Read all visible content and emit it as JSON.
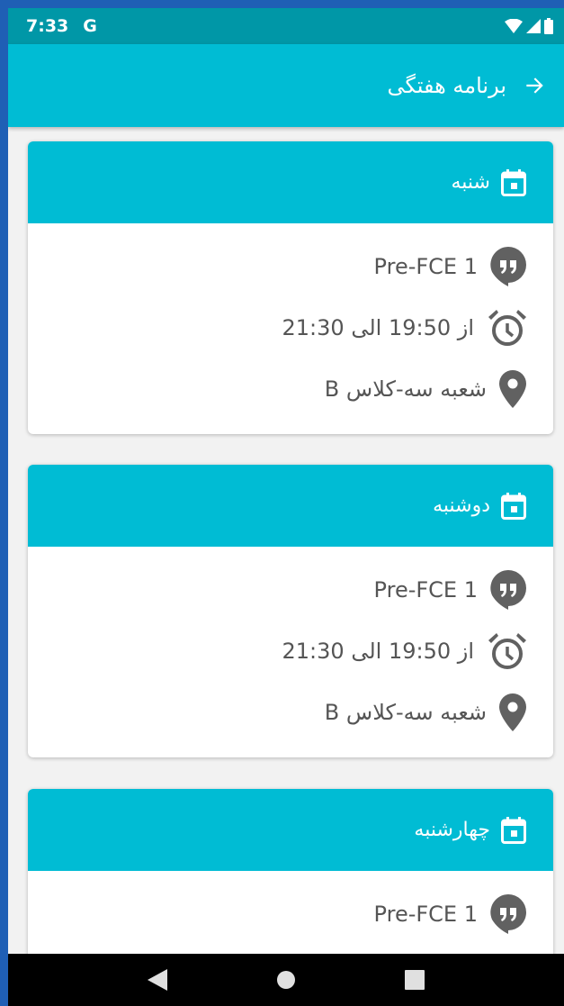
{
  "status_bar": {
    "time": "7:33",
    "app_glyph": "G"
  },
  "app_bar": {
    "title": "برنامه هفتگی",
    "back_icon": "arrow-right-icon"
  },
  "cards": [
    {
      "day": "شنبه",
      "course": "Pre-FCE 1",
      "time": "از 19:50 الی 21:30",
      "location": "شعبه سه-کلاس B"
    },
    {
      "day": "دوشنبه",
      "course": "Pre-FCE 1",
      "time": "از 19:50 الی 21:30",
      "location": "شعبه سه-کلاس B"
    },
    {
      "day": "چهارشنبه",
      "course": "Pre-FCE 1"
    }
  ],
  "colors": {
    "accent": "#00bcd4",
    "status_bar": "#0097a7",
    "icon_gray": "#616161"
  }
}
